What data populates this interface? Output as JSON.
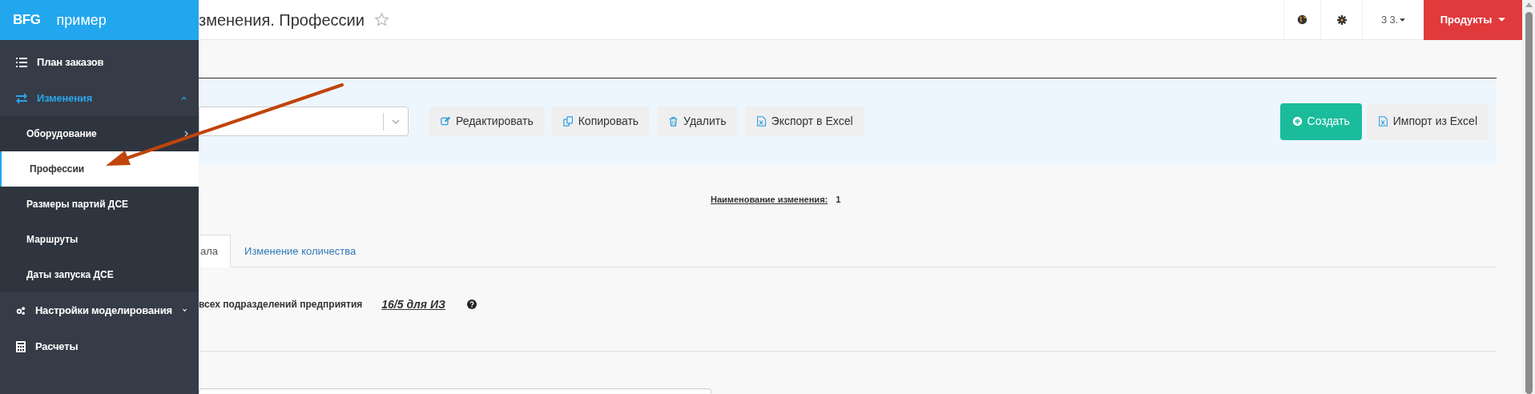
{
  "sidebar": {
    "logo": "BFG",
    "brand": "пример",
    "items": [
      {
        "label": "План заказов",
        "selected": false
      },
      {
        "label": "Изменения",
        "selected": false,
        "expanded": true,
        "children": [
          {
            "label": "Оборудование",
            "selected": false,
            "expanded": false
          },
          {
            "label": "Профессии",
            "selected": true
          },
          {
            "label": "Размеры партий ДСЕ",
            "selected": false
          },
          {
            "label": "Маршруты",
            "selected": false
          },
          {
            "label": "Даты запуска ДСЕ",
            "selected": false
          }
        ]
      },
      {
        "label": "Настройки моделирования",
        "selected": false,
        "expanded": false
      },
      {
        "label": "Расчеты",
        "selected": false
      }
    ]
  },
  "header": {
    "title": "зменения. Профессии",
    "starred": false,
    "user": "З З.",
    "products": "Продукты"
  },
  "toolbar": {
    "buttons": [
      {
        "kind": "edit",
        "label": "Редактировать"
      },
      {
        "kind": "copy",
        "label": "Копировать"
      },
      {
        "kind": "delete",
        "label": "Удалить"
      },
      {
        "kind": "export",
        "label": "Экспорт в Excel"
      },
      {
        "kind": "create",
        "label": "Создать"
      },
      {
        "kind": "import",
        "label": "Импорт из Excel"
      }
    ]
  },
  "summary": {
    "label": "Наименование изменения:",
    "value": "1"
  },
  "tabs": [
    {
      "label": "ала",
      "selected": true
    },
    {
      "label": "Изменение количества",
      "selected": false
    }
  ],
  "setting": {
    "label": "всех подразделений предприятия",
    "value": "16/5 для ИЗ"
  }
}
